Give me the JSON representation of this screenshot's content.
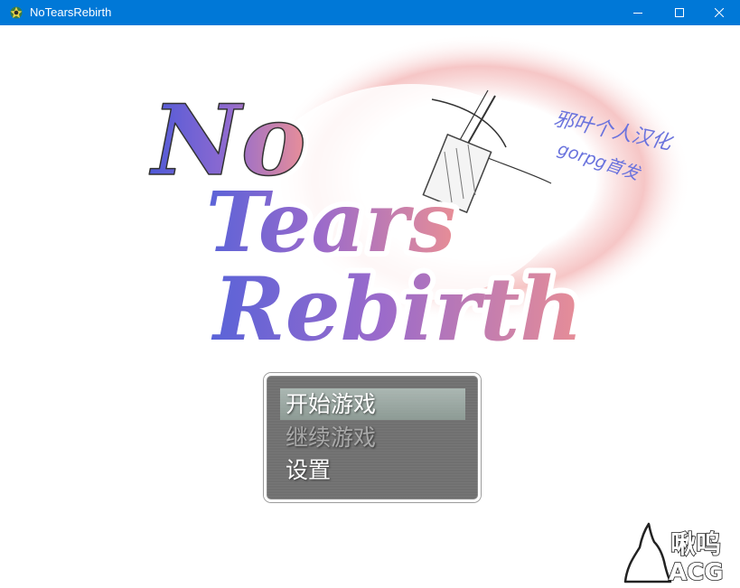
{
  "window": {
    "title": "NoTearsRebirth",
    "controls": [
      "minimize-icon",
      "maximize-icon",
      "close-icon"
    ]
  },
  "logo": {
    "line1": "No",
    "line2": "Tears",
    "line3": "Rebirth",
    "credit_line1": "邪叶个人汉化",
    "credit_line2": "gorpg首发"
  },
  "menu": {
    "items": [
      {
        "label": "开始游戏",
        "state": "selected"
      },
      {
        "label": "继续游戏",
        "state": "disabled"
      },
      {
        "label": "设置",
        "state": "normal"
      }
    ]
  },
  "watermark": {
    "line1": "啾呜",
    "line2": "ACG"
  },
  "colors": {
    "titlebar": "#0078d7",
    "logo_blue": "#5b63d6",
    "logo_pink": "#e8909a",
    "menu_bg": "#5c5c5c"
  }
}
